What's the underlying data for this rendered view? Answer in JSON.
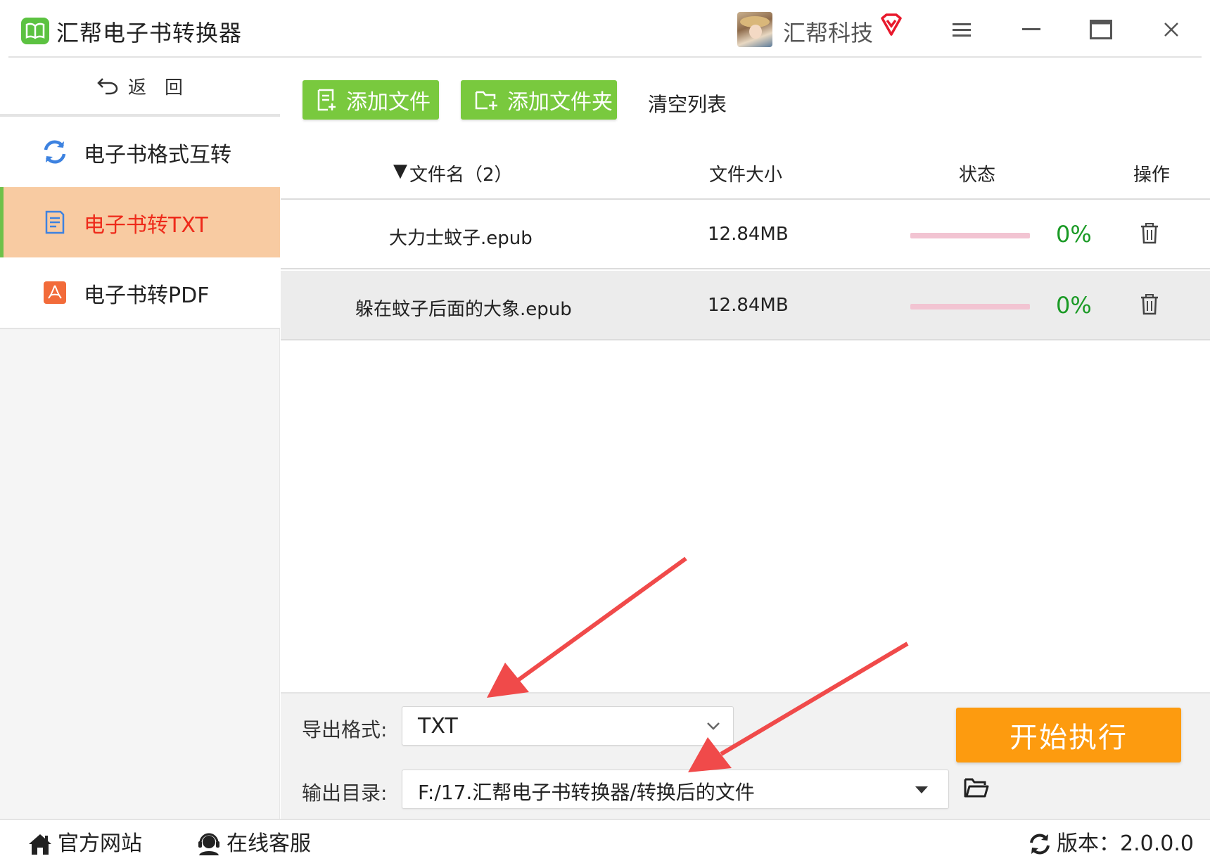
{
  "app": {
    "title": "汇帮电子书转换器",
    "user_name": "汇帮科技"
  },
  "sidebar": {
    "back_label": "返　回",
    "items": [
      {
        "label": "电子书格式互转",
        "icon": "refresh-icon",
        "active": false
      },
      {
        "label": "电子书转TXT",
        "icon": "document-icon",
        "active": true
      },
      {
        "label": "电子书转PDF",
        "icon": "pdf-icon",
        "active": false
      }
    ]
  },
  "toolbar": {
    "add_file_label": "添加文件",
    "add_folder_label": "添加文件夹",
    "clear_label": "清空列表"
  },
  "table": {
    "headers": {
      "name": "文件名（2）",
      "size": "文件大小",
      "status": "状态",
      "action": "操作"
    },
    "rows": [
      {
        "name": "大力士蚊子.epub",
        "size": "12.84MB",
        "progress": 0,
        "percent": "0%"
      },
      {
        "name": "躲在蚊子后面的大象.epub",
        "size": "12.84MB",
        "progress": 0,
        "percent": "0%"
      }
    ]
  },
  "settings": {
    "format_label": "导出格式:",
    "format_value": "TXT",
    "output_label": "输出目录:",
    "output_value": "F:/17.汇帮电子书转换器/转换后的文件",
    "start_label": "开始执行"
  },
  "footer": {
    "website_label": "官方网站",
    "support_label": "在线客服",
    "version_label": "版本：2.0.0.0"
  },
  "colors": {
    "accent_green": "#79c93e",
    "active_bg": "#f8cba2",
    "active_text": "#ee2a1a",
    "start_orange": "#fd9b0f",
    "percent_green": "#1a9a25",
    "annotation_red": "#f04a4a"
  }
}
